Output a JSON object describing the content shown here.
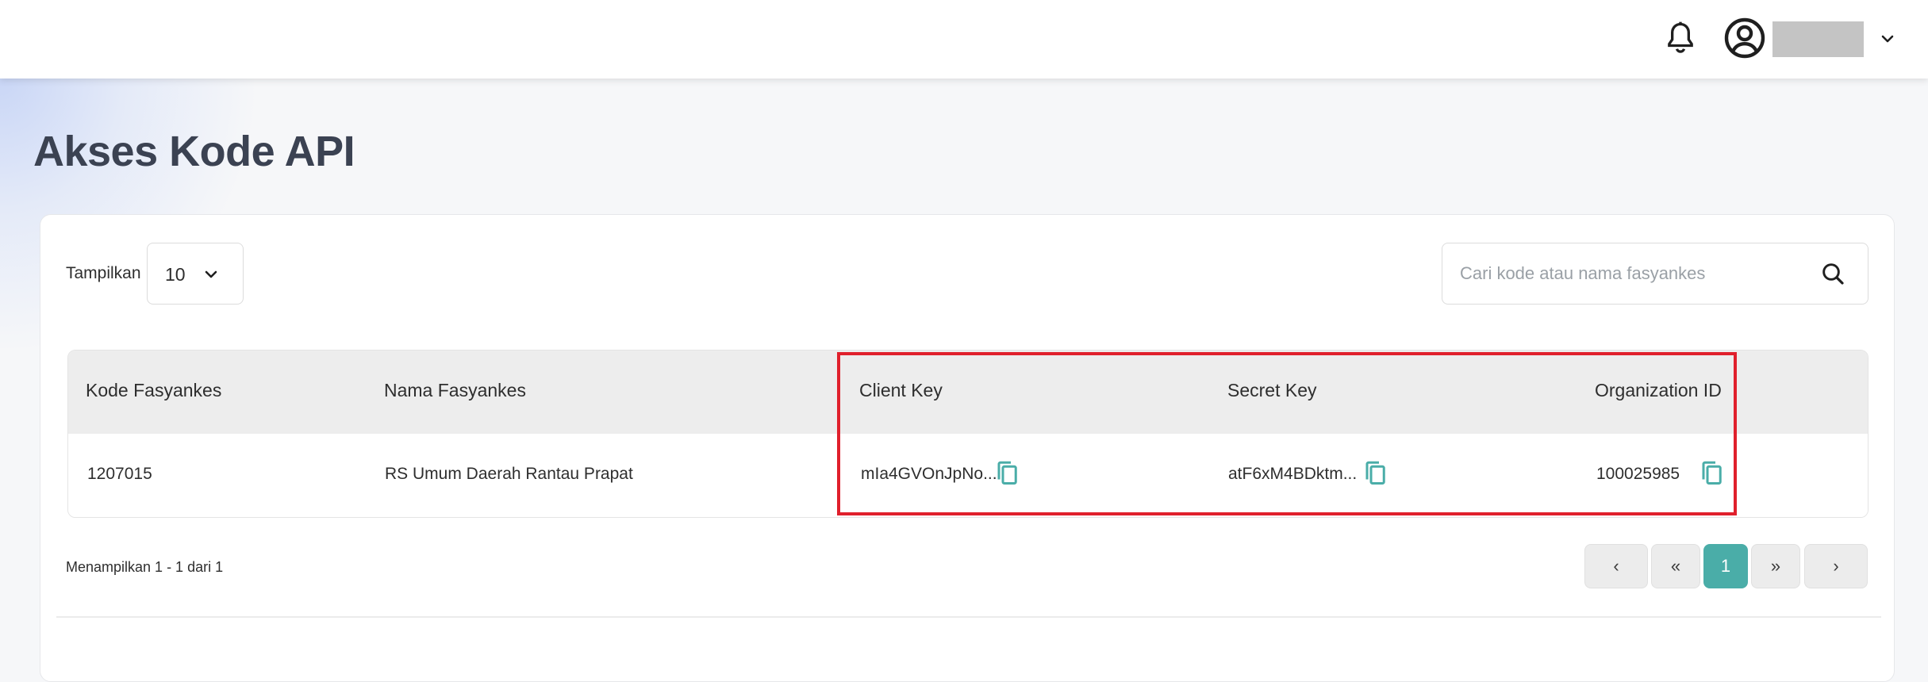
{
  "header": {
    "user_name": ""
  },
  "page": {
    "title": "Akses Kode API"
  },
  "controls": {
    "show_label": "Tampilkan",
    "page_size": "10",
    "search_placeholder": "Cari kode atau nama fasyankes",
    "search_value": ""
  },
  "table": {
    "columns": [
      "Kode Fasyankes",
      "Nama Fasyankes",
      "Client Key",
      "Secret Key",
      "Organization ID"
    ],
    "rows": [
      {
        "kode": "1207015",
        "nama": "RS Umum Daerah Rantau Prapat",
        "client_key": "mIa4GVOnJpNo...",
        "secret_key": "atF6xM4BDktm...",
        "organization_id": "100025985"
      }
    ]
  },
  "pagination": {
    "summary": "Menampilkan 1 - 1 dari 1",
    "prev": "‹",
    "first": "«",
    "current": "1",
    "last": "»",
    "next": "›"
  },
  "colors": {
    "accent": "#4aada8",
    "highlight": "#e0202c",
    "header_bg": "#ededed"
  },
  "icons": [
    "bell-icon",
    "user-circle-icon",
    "chevron-down-icon",
    "search-icon",
    "copy-icon"
  ]
}
